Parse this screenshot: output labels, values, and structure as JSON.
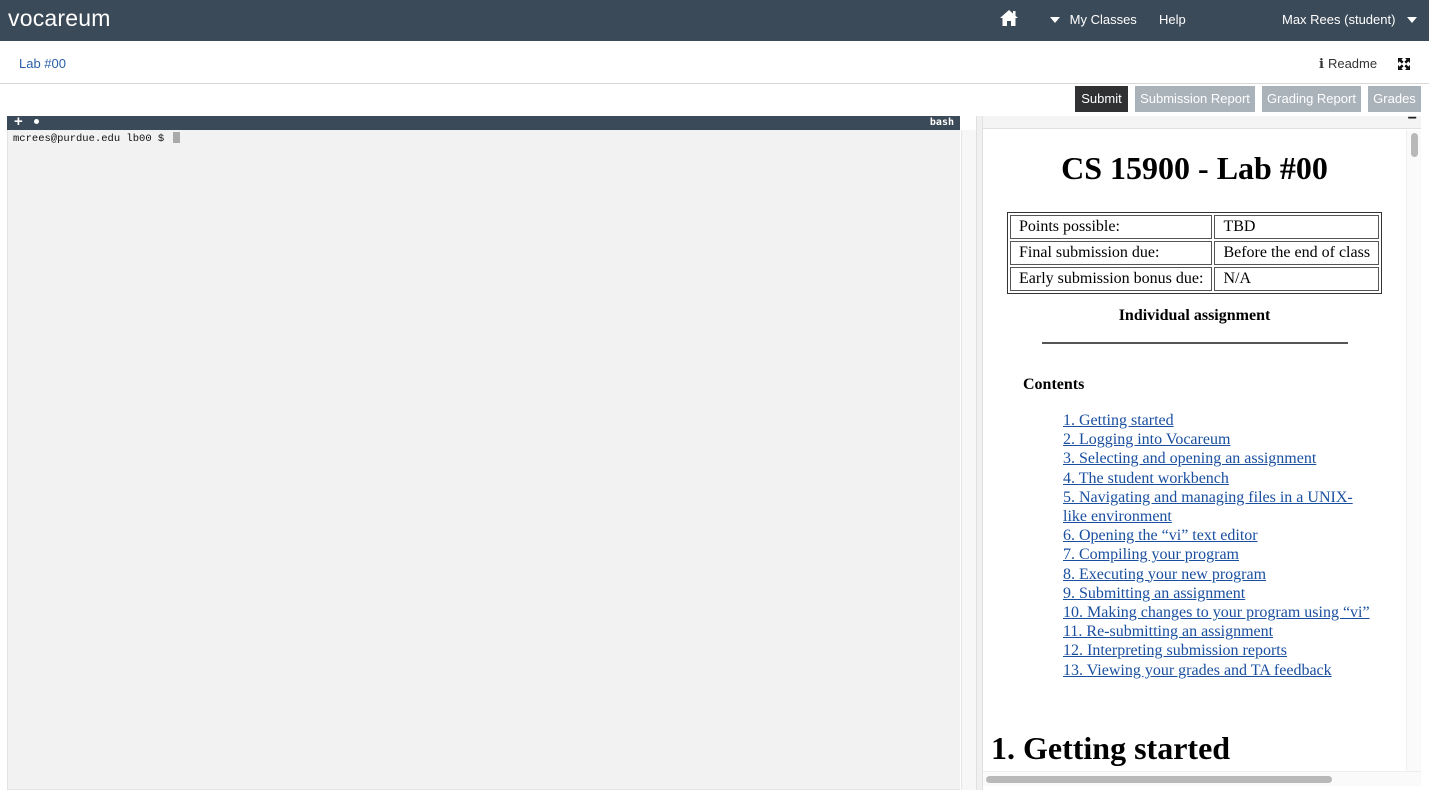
{
  "nav": {
    "logo": "vocareum",
    "my_classes": "My Classes",
    "help": "Help",
    "user": "Max Rees (student)"
  },
  "breadcrumb": {
    "lab": "Lab #00"
  },
  "readme_link": "Readme",
  "actions": {
    "submit": "Submit",
    "submission_report": "Submission Report",
    "grading_report": "Grading Report",
    "grades": "Grades"
  },
  "terminal": {
    "tab": "bash",
    "prompt": "mcrees@purdue.edu lb00 $ "
  },
  "doc": {
    "title": "CS 15900 - Lab #00",
    "info_rows": [
      {
        "label": "Points possible:",
        "value": "TBD"
      },
      {
        "label": "Final submission due:",
        "value": "Before the end of class"
      },
      {
        "label": "Early submission bonus due:",
        "value": "N/A"
      }
    ],
    "subtitle": "Individual assignment",
    "contents_heading": "Contents",
    "toc": [
      "1.   Getting started",
      "2.   Logging into Vocareum",
      "3.   Selecting and opening an assignment",
      "4.   The student workbench",
      "5.   Navigating and managing files in a UNIX-like environment",
      "6.   Opening the “vi” text editor",
      "7.   Compiling your program",
      "8.   Executing your new program",
      "9.   Submitting an assignment",
      "10.   Making changes to your program using “vi”",
      "11.   Re-submitting an assignment",
      "12.   Interpreting submission reports",
      "13.   Viewing your grades and TA feedback"
    ],
    "section_heading": "1.   Getting started"
  },
  "icons": {
    "home": "home-icon",
    "caret": "caret-down-icon",
    "info": "info-icon",
    "expand": "expand-icon",
    "plus": "plus-icon",
    "minimize": "minimize-icon"
  },
  "colors": {
    "navbar": "#3b4a58",
    "submit_bg": "#2f3133",
    "inactive_btn_bg": "#aab2ba",
    "link": "#1a4fa0",
    "terminal_bg": "#f2f2f2"
  }
}
